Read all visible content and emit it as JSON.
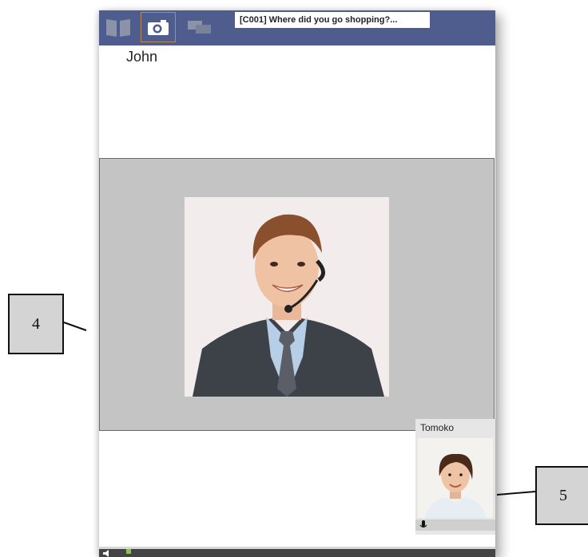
{
  "toolbar": {
    "session_title": "[C001] Where did you go shopping?...",
    "accent": "#4f5d8e"
  },
  "caller": {
    "name": "John"
  },
  "pip": {
    "name": "Tomoko"
  },
  "callouts": {
    "label_4": "4",
    "label_5": "5"
  }
}
